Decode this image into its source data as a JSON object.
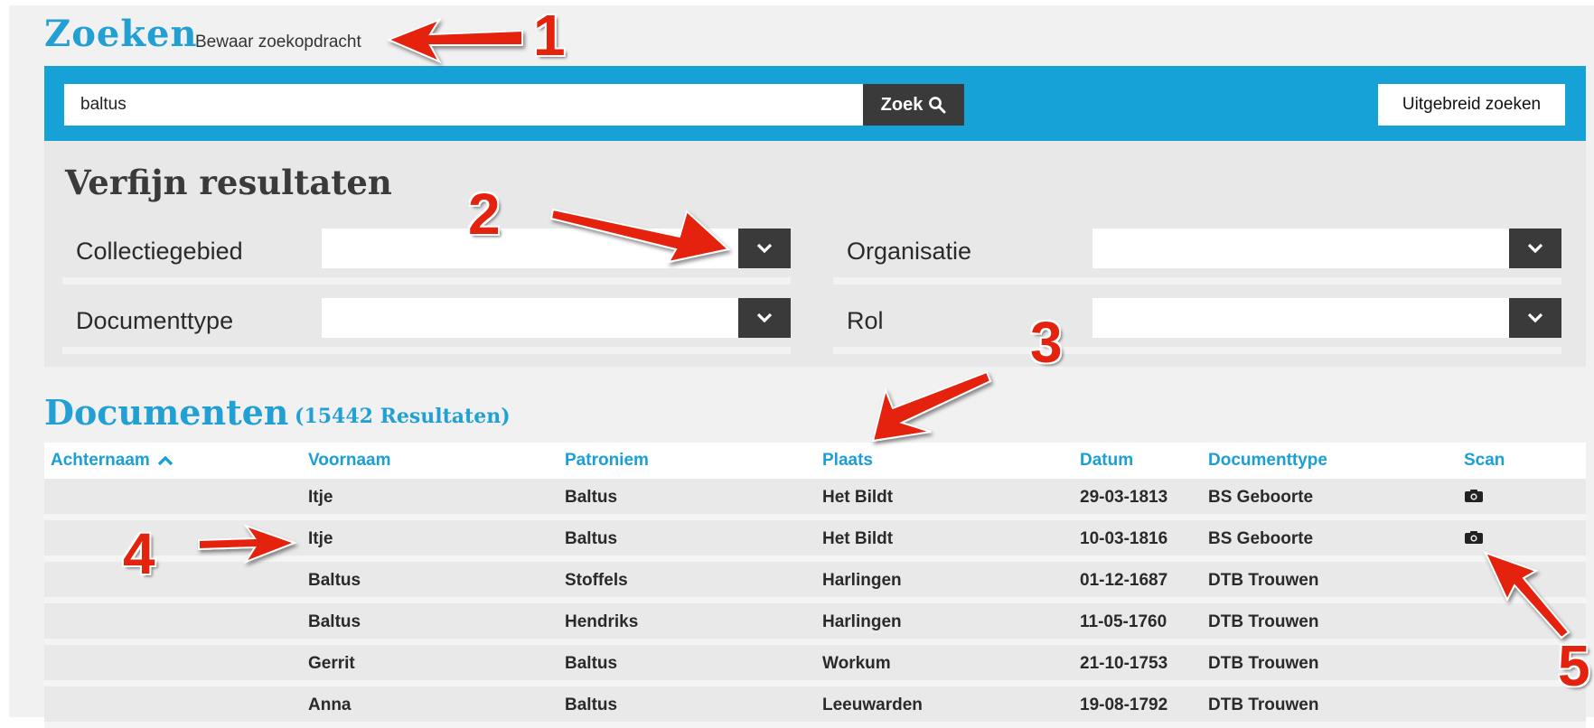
{
  "header": {
    "title": "Zoeken",
    "save_search_label": "Bewaar zoekopdracht"
  },
  "search": {
    "value": "baltus",
    "search_button_label": "Zoek",
    "advanced_button_label": "Uitgebreid zoeken"
  },
  "refine": {
    "title": "Verfijn resultaten",
    "filters": [
      {
        "label": "Collectiegebied",
        "value": ""
      },
      {
        "label": "Organisatie",
        "value": ""
      },
      {
        "label": "Documenttype",
        "value": ""
      },
      {
        "label": "Rol",
        "value": ""
      }
    ]
  },
  "documents": {
    "title": "Documenten",
    "count_label": "(15442 Resultaten)",
    "columns": [
      "Achternaam",
      "Voornaam",
      "Patroniem",
      "Plaats",
      "Datum",
      "Documenttype",
      "Scan"
    ],
    "rows": [
      {
        "achternaam": "",
        "voornaam": "Itje",
        "patroniem": "Baltus",
        "plaats": "Het Bildt",
        "datum": "29-03-1813",
        "documenttype": "BS Geboorte",
        "scan": true
      },
      {
        "achternaam": "",
        "voornaam": "Itje",
        "patroniem": "Baltus",
        "plaats": "Het Bildt",
        "datum": "10-03-1816",
        "documenttype": "BS Geboorte",
        "scan": true
      },
      {
        "achternaam": "",
        "voornaam": "Baltus",
        "patroniem": "Stoffels",
        "plaats": "Harlingen",
        "datum": "01-12-1687",
        "documenttype": "DTB Trouwen",
        "scan": false
      },
      {
        "achternaam": "",
        "voornaam": "Baltus",
        "patroniem": "Hendriks",
        "plaats": "Harlingen",
        "datum": "11-05-1760",
        "documenttype": "DTB Trouwen",
        "scan": false
      },
      {
        "achternaam": "",
        "voornaam": "Gerrit",
        "patroniem": "Baltus",
        "plaats": "Workum",
        "datum": "21-10-1753",
        "documenttype": "DTB Trouwen",
        "scan": false
      },
      {
        "achternaam": "",
        "voornaam": "Anna",
        "patroniem": "Baltus",
        "plaats": "Leeuwarden",
        "datum": "19-08-1792",
        "documenttype": "DTB Trouwen",
        "scan": false
      }
    ]
  },
  "annotations": [
    "1",
    "2",
    "3",
    "4",
    "5"
  ],
  "colors": {
    "accent": "#16a2d6",
    "dark_button": "#3a3a3a",
    "annotation": "#e4230f"
  }
}
